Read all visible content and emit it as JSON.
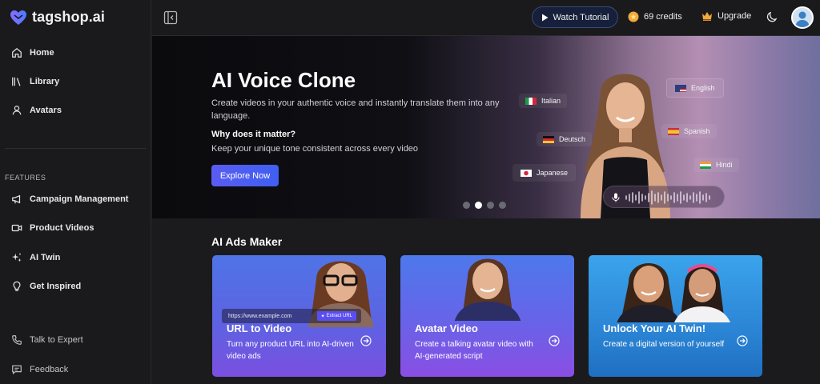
{
  "brand": {
    "name": "tagshop.ai"
  },
  "sidebar": {
    "items": [
      {
        "label": "Home"
      },
      {
        "label": "Library"
      },
      {
        "label": "Avatars"
      }
    ],
    "features_label": "FEATURES",
    "features": [
      {
        "label": "Campaign Management"
      },
      {
        "label": "Product Videos"
      },
      {
        "label": "AI Twin"
      },
      {
        "label": "Get Inspired"
      }
    ],
    "bottom": [
      {
        "label": "Talk to Expert"
      },
      {
        "label": "Feedback"
      }
    ]
  },
  "topbar": {
    "watch_label": "Watch Tutorial",
    "credits_label": "69 credits",
    "upgrade_label": "Upgrade"
  },
  "hero": {
    "title": "AI Voice Clone",
    "description": "Create videos in your authentic voice and instantly translate them into any language.",
    "why_title": "Why does it matter?",
    "why_text": "Keep your unique tone consistent across every video",
    "cta_label": "Explore Now",
    "languages": [
      "Italian",
      "English",
      "Deutsch",
      "Spanish",
      "Japanese",
      "Hindi"
    ],
    "slide_count": 4,
    "active_slide": 2
  },
  "section": {
    "title": "AI Ads Maker",
    "cards": [
      {
        "title": "URL to Video",
        "description": "Turn any product URL into AI-driven video ads",
        "url_placeholder": "https://www.example.com",
        "extract_label": "Extract URL"
      },
      {
        "title": "Avatar Video",
        "description": "Create a talking avatar video with AI-generated script"
      },
      {
        "title": "Unlock Your AI Twin!",
        "description": "Create a digital version of yourself"
      }
    ]
  },
  "colors": {
    "accent": "#4f5ef2",
    "background": "#1b1b1d",
    "card_purple": "#6a5ee6",
    "card_blue": "#2d88d8"
  }
}
